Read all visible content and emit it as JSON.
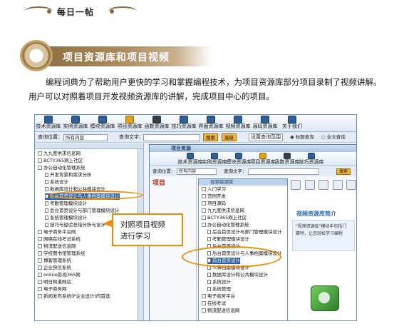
{
  "header": {
    "title": "每日一帖"
  },
  "section": {
    "title": "项目资源库和项目视频"
  },
  "intro": {
    "text": "编程词典为了帮助用户更快的学习和掌握编程技术，为项目资源库部分项目录制了视频讲解。用户可以对照着项目开发视频资源库的讲解，完成项目中心的项目。"
  },
  "figure": {
    "toolbar": [
      "技术资源库",
      "实例资源库",
      "模块资源库",
      "项目资源库",
      "函数资源库",
      "技巧资源库",
      "界面资源库",
      "视频资源库",
      "源码资源库",
      "关于我们"
    ],
    "query": {
      "position_label": "查询位置：",
      "position_value": "所有内容",
      "text_label": "查询文字：",
      "search_btn": "搜索",
      "advanced_btn": "高级",
      "set_label": "设置查询范围",
      "opt_title": "标题查询",
      "opt_full": "全文查询"
    },
    "tree": [
      {
        "text": "九九度供求信息网",
        "type": "folder"
      },
      {
        "text": "BCTY365网上社区",
        "type": "folder"
      },
      {
        "text": "办公自动化管理系统",
        "type": "folder"
      },
      {
        "text": "开发背景和需求分析",
        "type": "doc"
      },
      {
        "text": "系统设计",
        "type": "doc"
      },
      {
        "text": "数据库设计和公共模块设计",
        "type": "doc"
      },
      {
        "text": "后台首页设计与人事档案模块设计",
        "type": "doc",
        "selected": true
      },
      {
        "text": "考勤管理模块设计",
        "type": "doc"
      },
      {
        "text": "后台首页设计与部门管理模块设计",
        "type": "doc"
      },
      {
        "text": "系统管理模块设计",
        "type": "doc"
      },
      {
        "text": "技巧与经验总结分析与设计",
        "type": "doc"
      },
      {
        "text": "电子商务平台网",
        "type": "folder"
      },
      {
        "text": "网络在线考试系统",
        "type": "folder"
      },
      {
        "text": "物流配送信息网",
        "type": "folder"
      },
      {
        "text": "学校图书馆管理系统",
        "type": "folder"
      },
      {
        "text": "博客管理系统",
        "type": "folder"
      },
      {
        "text": "企业快信系统",
        "type": "folder"
      },
      {
        "text": "online影视365网",
        "type": "folder"
      },
      {
        "text": "明日知道网站",
        "type": "folder"
      },
      {
        "text": "电子商务网",
        "type": "folder"
      },
      {
        "text": "新闻发布系统(P企业设计)的首选",
        "type": "folder"
      }
    ],
    "inner": {
      "window_title": "项目资源",
      "toolbar": [
        "技术资源库",
        "实例资源库",
        "模块资源库",
        "项目资源库",
        "函数资源库",
        "技巧资源库"
      ],
      "query": {
        "position_label": "查询位置：",
        "position_value": "所有内容",
        "text_label": "查询文字：",
        "search_btn": "搜索"
      },
      "project_label": "项目",
      "dropdown_title": "视频资源库",
      "dropdown_items": [
        {
          "text": "入门学习",
          "type": "folder"
        },
        {
          "text": "范例开发",
          "type": "folder"
        },
        {
          "text": "项目源码",
          "type": "folder"
        },
        {
          "text": "九九度供求信息网",
          "type": "folder"
        },
        {
          "text": "BCTY365网上社区",
          "type": "folder"
        },
        {
          "text": "办公自动化管理系统",
          "type": "folder"
        },
        {
          "text": "后台首页设计与部门管理模块设计",
          "type": "doc"
        },
        {
          "text": "考勤管理模块设计",
          "type": "doc"
        },
        {
          "text": "后台首页设计",
          "type": "doc"
        },
        {
          "text": "后台首页设计与人事档案模块设计",
          "type": "doc"
        },
        {
          "text": "前台首页设计",
          "type": "doc",
          "selected": true
        },
        {
          "text": "人事档案模块设计",
          "type": "doc"
        },
        {
          "text": "数据库设计和公共模块设计",
          "type": "doc"
        },
        {
          "text": "系统设计",
          "type": "doc"
        },
        {
          "text": "系统管理",
          "type": "doc"
        },
        {
          "text": "电子商务平台",
          "type": "folder"
        },
        {
          "text": "在线考试",
          "type": "folder"
        },
        {
          "text": "物流配送信息网",
          "type": "folder"
        }
      ],
      "video_title": "视频资源库简介",
      "video_desc_1": "\"视频资源库\"模块中包括门",
      "video_desc_2": "赛特，让您轻松学习编程"
    },
    "callout": {
      "line1": "对照项目视频",
      "line2": "进行学习"
    }
  }
}
